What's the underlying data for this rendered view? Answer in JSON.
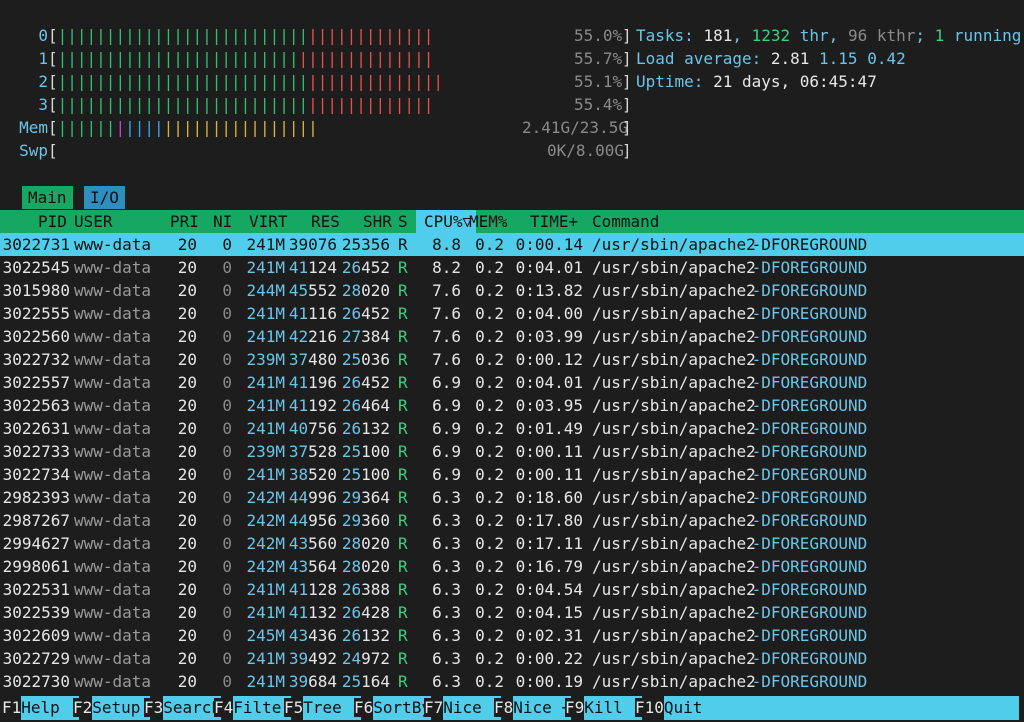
{
  "meters": {
    "cpus": [
      {
        "label": "0",
        "pct": "55.0%"
      },
      {
        "label": "1",
        "pct": "55.7%"
      },
      {
        "label": "2",
        "pct": "55.1%"
      },
      {
        "label": "3",
        "pct": "55.4%"
      }
    ],
    "mem": {
      "label": "Mem",
      "value": "2.41G/23.5G"
    },
    "swp": {
      "label": "Swp",
      "value": "0K/8.00G"
    }
  },
  "info": {
    "tasks_label": "Tasks: ",
    "tasks": "181",
    "thr": "1232",
    "thr_label": " thr",
    "kthr": "96",
    "kthr_label": " kthr",
    "running": "1",
    "running_label": " running",
    "load_label": "Load average: ",
    "load1": "2.81",
    "load5": "1.15",
    "load15": "0.42",
    "uptime_label": "Uptime: ",
    "uptime": "21 days, 06:45:47"
  },
  "tabs": [
    {
      "label": "Main"
    },
    {
      "label": "I/O"
    }
  ],
  "columns": {
    "pid": "PID",
    "user": "USER",
    "pri": "PRI",
    "ni": "NI",
    "virt": "VIRT",
    "res": "RES",
    "shr": "SHR",
    "s": "S",
    "cpu": "CPU%▽",
    "mem": "MEM%",
    "time": "TIME+",
    "cmd": "Command"
  },
  "processes": [
    {
      "pid": "3022731",
      "user": "www-data",
      "pri": "20",
      "ni": "0",
      "virt": "241M",
      "res": "39076",
      "shr": "25356",
      "s": "R",
      "cpu": "8.8",
      "mem": "0.2",
      "time": "0:00.14",
      "cmd": "/usr/sbin/apache2",
      "args": " -DFOREGROUND"
    },
    {
      "pid": "3022545",
      "user": "www-data",
      "pri": "20",
      "ni": "0",
      "virt": "241M",
      "res": "41124",
      "shr": "26452",
      "s": "R",
      "cpu": "8.2",
      "mem": "0.2",
      "time": "0:04.01",
      "cmd": "/usr/sbin/apache2",
      "args": " -DFOREGROUND"
    },
    {
      "pid": "3015980",
      "user": "www-data",
      "pri": "20",
      "ni": "0",
      "virt": "244M",
      "res": "45552",
      "shr": "28020",
      "s": "R",
      "cpu": "7.6",
      "mem": "0.2",
      "time": "0:13.82",
      "cmd": "/usr/sbin/apache2",
      "args": " -DFOREGROUND"
    },
    {
      "pid": "3022555",
      "user": "www-data",
      "pri": "20",
      "ni": "0",
      "virt": "241M",
      "res": "41116",
      "shr": "26452",
      "s": "R",
      "cpu": "7.6",
      "mem": "0.2",
      "time": "0:04.00",
      "cmd": "/usr/sbin/apache2",
      "args": " -DFOREGROUND"
    },
    {
      "pid": "3022560",
      "user": "www-data",
      "pri": "20",
      "ni": "0",
      "virt": "241M",
      "res": "42216",
      "shr": "27384",
      "s": "R",
      "cpu": "7.6",
      "mem": "0.2",
      "time": "0:03.99",
      "cmd": "/usr/sbin/apache2",
      "args": " -DFOREGROUND"
    },
    {
      "pid": "3022732",
      "user": "www-data",
      "pri": "20",
      "ni": "0",
      "virt": "239M",
      "res": "37480",
      "shr": "25036",
      "s": "R",
      "cpu": "7.6",
      "mem": "0.2",
      "time": "0:00.12",
      "cmd": "/usr/sbin/apache2",
      "args": " -DFOREGROUND"
    },
    {
      "pid": "3022557",
      "user": "www-data",
      "pri": "20",
      "ni": "0",
      "virt": "241M",
      "res": "41196",
      "shr": "26452",
      "s": "R",
      "cpu": "6.9",
      "mem": "0.2",
      "time": "0:04.01",
      "cmd": "/usr/sbin/apache2",
      "args": " -DFOREGROUND"
    },
    {
      "pid": "3022563",
      "user": "www-data",
      "pri": "20",
      "ni": "0",
      "virt": "241M",
      "res": "41192",
      "shr": "26464",
      "s": "R",
      "cpu": "6.9",
      "mem": "0.2",
      "time": "0:03.95",
      "cmd": "/usr/sbin/apache2",
      "args": " -DFOREGROUND"
    },
    {
      "pid": "3022631",
      "user": "www-data",
      "pri": "20",
      "ni": "0",
      "virt": "241M",
      "res": "40756",
      "shr": "26132",
      "s": "R",
      "cpu": "6.9",
      "mem": "0.2",
      "time": "0:01.49",
      "cmd": "/usr/sbin/apache2",
      "args": " -DFOREGROUND"
    },
    {
      "pid": "3022733",
      "user": "www-data",
      "pri": "20",
      "ni": "0",
      "virt": "239M",
      "res": "37528",
      "shr": "25100",
      "s": "R",
      "cpu": "6.9",
      "mem": "0.2",
      "time": "0:00.11",
      "cmd": "/usr/sbin/apache2",
      "args": " -DFOREGROUND"
    },
    {
      "pid": "3022734",
      "user": "www-data",
      "pri": "20",
      "ni": "0",
      "virt": "241M",
      "res": "38520",
      "shr": "25100",
      "s": "R",
      "cpu": "6.9",
      "mem": "0.2",
      "time": "0:00.11",
      "cmd": "/usr/sbin/apache2",
      "args": " -DFOREGROUND"
    },
    {
      "pid": "2982393",
      "user": "www-data",
      "pri": "20",
      "ni": "0",
      "virt": "242M",
      "res": "44996",
      "shr": "29364",
      "s": "R",
      "cpu": "6.3",
      "mem": "0.2",
      "time": "0:18.60",
      "cmd": "/usr/sbin/apache2",
      "args": " -DFOREGROUND"
    },
    {
      "pid": "2987267",
      "user": "www-data",
      "pri": "20",
      "ni": "0",
      "virt": "242M",
      "res": "44956",
      "shr": "29360",
      "s": "R",
      "cpu": "6.3",
      "mem": "0.2",
      "time": "0:17.80",
      "cmd": "/usr/sbin/apache2",
      "args": " -DFOREGROUND"
    },
    {
      "pid": "2994627",
      "user": "www-data",
      "pri": "20",
      "ni": "0",
      "virt": "242M",
      "res": "43560",
      "shr": "28020",
      "s": "R",
      "cpu": "6.3",
      "mem": "0.2",
      "time": "0:17.11",
      "cmd": "/usr/sbin/apache2",
      "args": " -DFOREGROUND"
    },
    {
      "pid": "2998061",
      "user": "www-data",
      "pri": "20",
      "ni": "0",
      "virt": "242M",
      "res": "43564",
      "shr": "28020",
      "s": "R",
      "cpu": "6.3",
      "mem": "0.2",
      "time": "0:16.79",
      "cmd": "/usr/sbin/apache2",
      "args": " -DFOREGROUND"
    },
    {
      "pid": "3022531",
      "user": "www-data",
      "pri": "20",
      "ni": "0",
      "virt": "241M",
      "res": "41128",
      "shr": "26388",
      "s": "R",
      "cpu": "6.3",
      "mem": "0.2",
      "time": "0:04.54",
      "cmd": "/usr/sbin/apache2",
      "args": " -DFOREGROUND"
    },
    {
      "pid": "3022539",
      "user": "www-data",
      "pri": "20",
      "ni": "0",
      "virt": "241M",
      "res": "41132",
      "shr": "26428",
      "s": "R",
      "cpu": "6.3",
      "mem": "0.2",
      "time": "0:04.15",
      "cmd": "/usr/sbin/apache2",
      "args": " -DFOREGROUND"
    },
    {
      "pid": "3022609",
      "user": "www-data",
      "pri": "20",
      "ni": "0",
      "virt": "245M",
      "res": "43436",
      "shr": "26132",
      "s": "R",
      "cpu": "6.3",
      "mem": "0.2",
      "time": "0:02.31",
      "cmd": "/usr/sbin/apache2",
      "args": " -DFOREGROUND"
    },
    {
      "pid": "3022729",
      "user": "www-data",
      "pri": "20",
      "ni": "0",
      "virt": "241M",
      "res": "39492",
      "shr": "24972",
      "s": "R",
      "cpu": "6.3",
      "mem": "0.2",
      "time": "0:00.22",
      "cmd": "/usr/sbin/apache2",
      "args": " -DFOREGROUND"
    },
    {
      "pid": "3022730",
      "user": "www-data",
      "pri": "20",
      "ni": "0",
      "virt": "241M",
      "res": "39684",
      "shr": "25164",
      "s": "R",
      "cpu": "6.3",
      "mem": "0.2",
      "time": "0:00.19",
      "cmd": "/usr/sbin/apache2",
      "args": " -DFOREGROUND"
    }
  ],
  "fkeys": [
    {
      "key": "F1",
      "label": "Help  "
    },
    {
      "key": "F2",
      "label": "Setup "
    },
    {
      "key": "F3",
      "label": "Search"
    },
    {
      "key": "F4",
      "label": "Filter"
    },
    {
      "key": "F5",
      "label": "Tree  "
    },
    {
      "key": "F6",
      "label": "SortBy"
    },
    {
      "key": "F7",
      "label": "Nice -"
    },
    {
      "key": "F8",
      "label": "Nice +"
    },
    {
      "key": "F9",
      "label": "Kill  "
    },
    {
      "key": "F10",
      "label": "Quit"
    }
  ],
  "colors": {
    "selection": "#4fcdea",
    "header": "#16a862",
    "background": "#1d1d1d"
  }
}
